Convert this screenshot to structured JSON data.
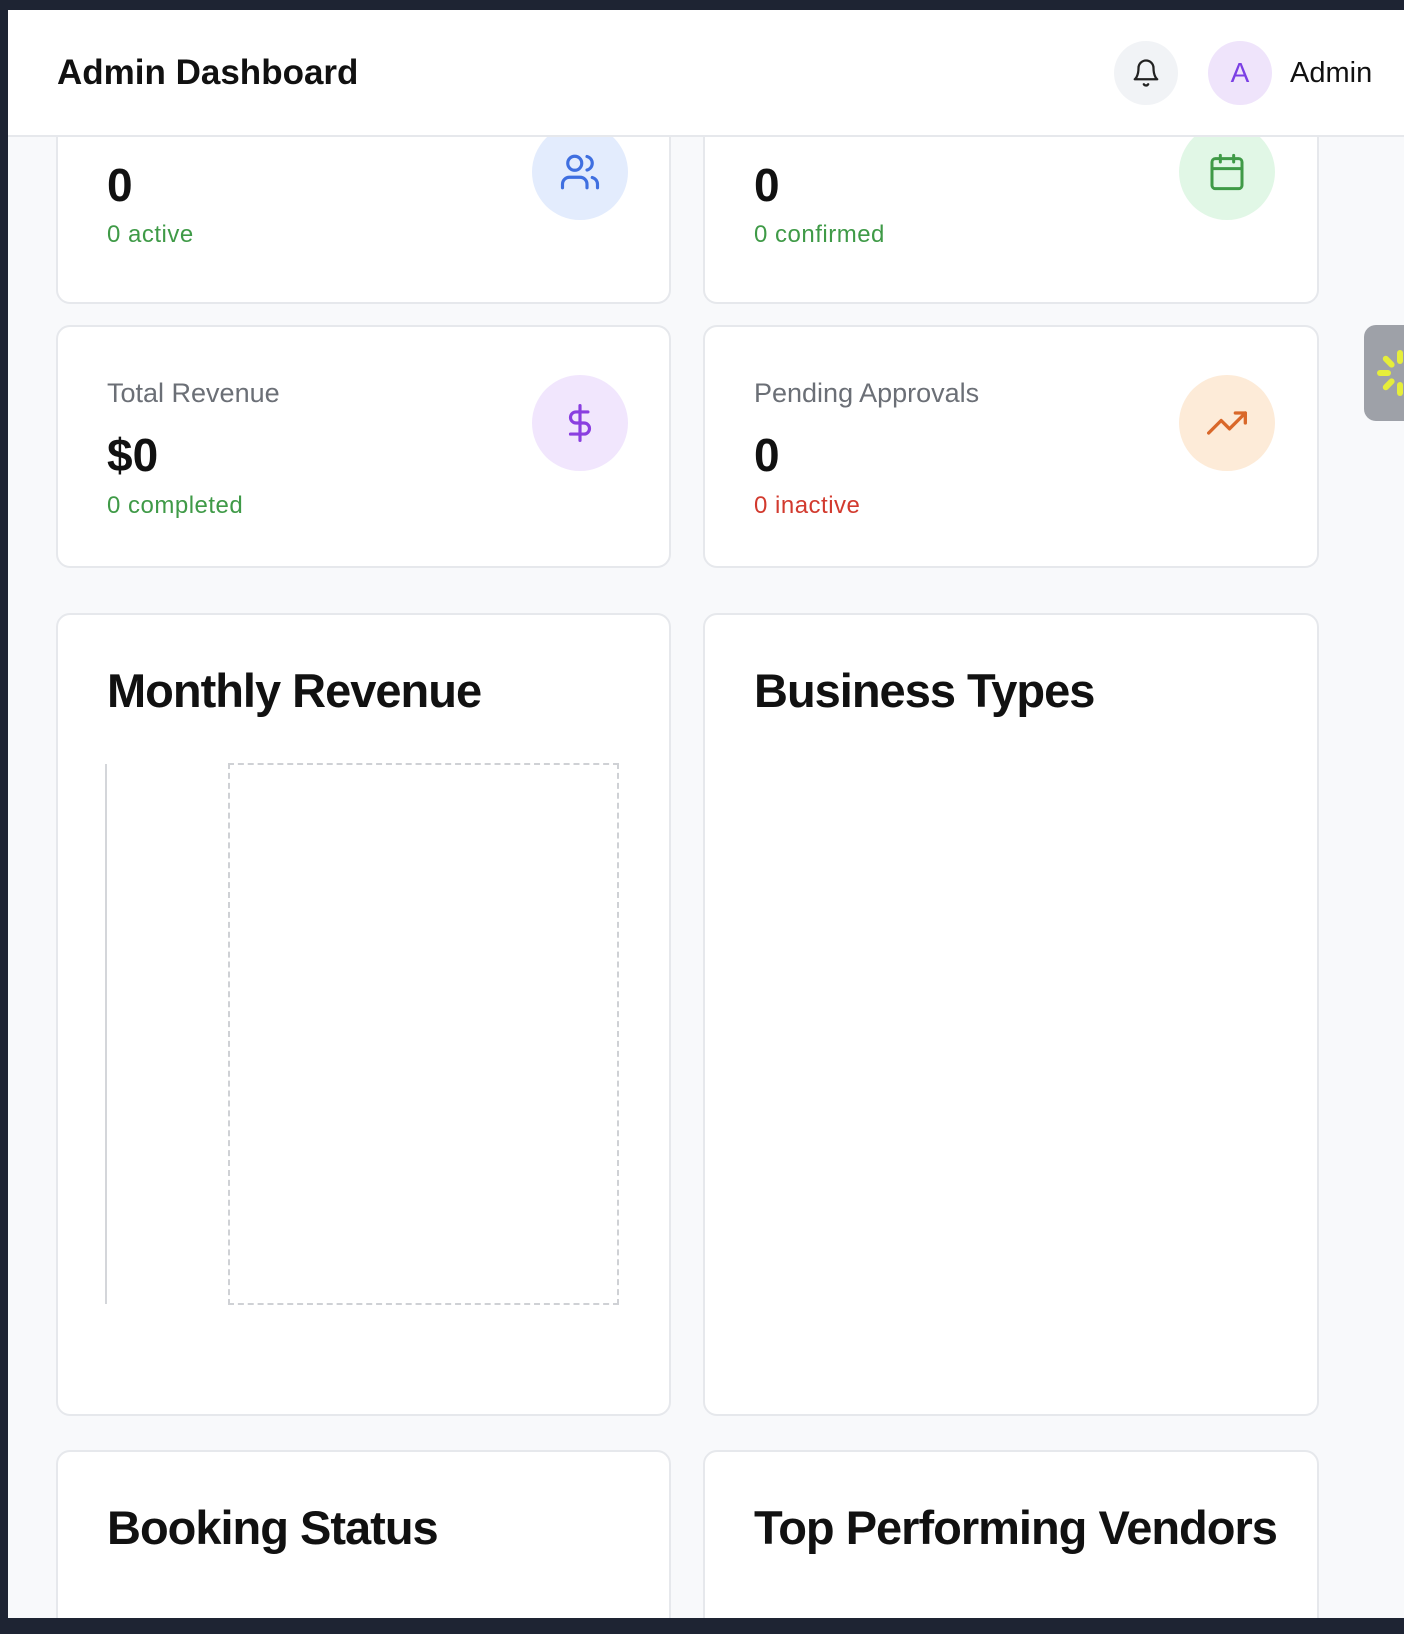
{
  "header": {
    "title": "Admin Dashboard",
    "avatar_initial": "A",
    "user_name": "Admin"
  },
  "stats": {
    "users": {
      "value": "0",
      "sub": "0 active"
    },
    "bookings": {
      "value": "0",
      "sub": "0 confirmed"
    },
    "revenue": {
      "label": "Total Revenue",
      "value": "$0",
      "sub": "0 completed"
    },
    "pending": {
      "label": "Pending Approvals",
      "value": "0",
      "sub": "0 inactive"
    }
  },
  "panels": {
    "monthly_revenue": "Monthly Revenue",
    "business_types": "Business Types",
    "booking_status": "Booking Status",
    "top_vendors": "Top Performing Vendors"
  },
  "colors": {
    "positive": "#3f9a47",
    "negative": "#d23a2e",
    "users_icon": "#3f6fe0",
    "bookings_icon": "#3f9a47",
    "revenue_icon": "#8a3fe0",
    "pending_icon": "#d9682a"
  },
  "icons": {
    "bell": "bell-icon",
    "users": "users-icon",
    "bookings": "calendar-icon",
    "revenue": "dollar-icon",
    "pending": "trending-up-icon"
  }
}
